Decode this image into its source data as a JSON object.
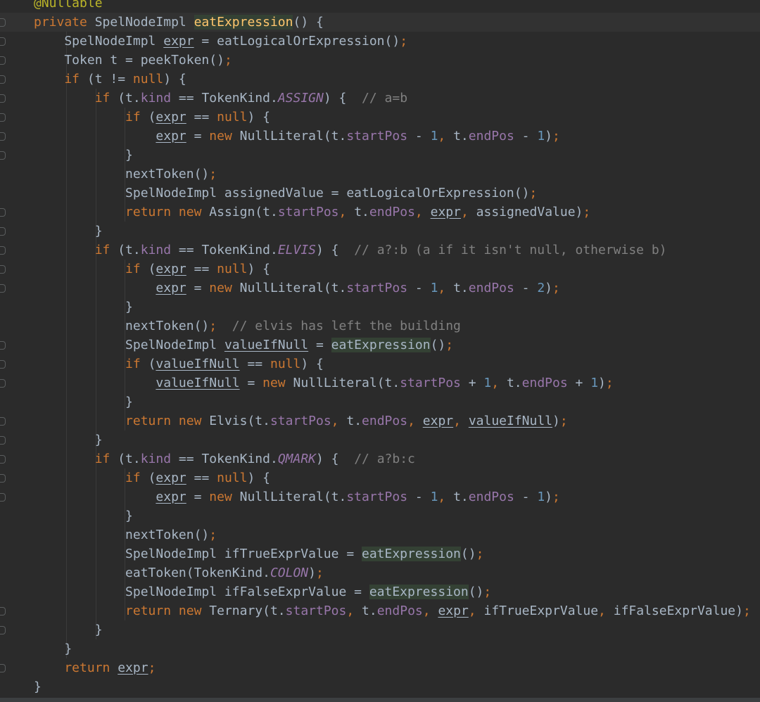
{
  "editor": {
    "language": "java",
    "lines": [
      [
        [
          "ann",
          "@Nullable"
        ]
      ],
      [
        [
          "kw",
          "private "
        ],
        [
          "",
          "SpelNodeImpl "
        ],
        [
          "fn hl",
          "eatExpression"
        ],
        [
          "",
          "() {"
        ]
      ],
      [
        [
          "",
          "    SpelNodeImpl "
        ],
        [
          "ul",
          "expr"
        ],
        [
          "",
          " = eatLogicalOrExpression()"
        ],
        [
          "kw",
          ";"
        ]
      ],
      [
        [
          "",
          "    Token t = peekToken()"
        ],
        [
          "kw",
          ";"
        ]
      ],
      [
        [
          "kw",
          "    if "
        ],
        [
          "",
          "(t != "
        ],
        [
          "kw",
          "null"
        ],
        [
          "",
          ") {"
        ]
      ],
      [
        [
          "",
          "        "
        ],
        [
          "kw",
          "if "
        ],
        [
          "",
          "(t."
        ],
        [
          "fld",
          "kind"
        ],
        [
          "",
          " == TokenKind."
        ],
        [
          "cst",
          "ASSIGN"
        ],
        [
          "",
          ") {  "
        ],
        [
          "cm",
          "// a=b"
        ]
      ],
      [
        [
          "",
          "            "
        ],
        [
          "kw",
          "if "
        ],
        [
          "",
          "("
        ],
        [
          "ul",
          "expr"
        ],
        [
          "",
          " == "
        ],
        [
          "kw",
          "null"
        ],
        [
          "",
          ") {"
        ]
      ],
      [
        [
          "",
          "                "
        ],
        [
          "ul",
          "expr"
        ],
        [
          "",
          " = "
        ],
        [
          "kw",
          "new "
        ],
        [
          "",
          "NullLiteral(t."
        ],
        [
          "fld",
          "startPos"
        ],
        [
          "",
          " - "
        ],
        [
          "num",
          "1"
        ],
        [
          "kw",
          ", "
        ],
        [
          "",
          "t."
        ],
        [
          "fld",
          "endPos"
        ],
        [
          "",
          " - "
        ],
        [
          "num",
          "1"
        ],
        [
          "",
          ")"
        ],
        [
          "kw",
          ";"
        ]
      ],
      [
        [
          "",
          "            }"
        ]
      ],
      [
        [
          "",
          "            nextToken()"
        ],
        [
          "kw",
          ";"
        ]
      ],
      [
        [
          "",
          "            SpelNodeImpl assignedValue = eatLogicalOrExpression()"
        ],
        [
          "kw",
          ";"
        ]
      ],
      [
        [
          "",
          "            "
        ],
        [
          "kw",
          "return new "
        ],
        [
          "",
          "Assign(t."
        ],
        [
          "fld",
          "startPos"
        ],
        [
          "kw",
          ", "
        ],
        [
          "",
          "t."
        ],
        [
          "fld",
          "endPos"
        ],
        [
          "kw",
          ", "
        ],
        [
          "ul",
          "expr"
        ],
        [
          "kw",
          ", "
        ],
        [
          "",
          "assignedValue)"
        ],
        [
          "kw",
          ";"
        ]
      ],
      [
        [
          "",
          "        }"
        ]
      ],
      [
        [
          "",
          "        "
        ],
        [
          "kw",
          "if "
        ],
        [
          "",
          "(t."
        ],
        [
          "fld",
          "kind"
        ],
        [
          "",
          " == TokenKind."
        ],
        [
          "cst",
          "ELVIS"
        ],
        [
          "",
          ") {  "
        ],
        [
          "cm",
          "// a?:b (a if it isn't null, otherwise b)"
        ]
      ],
      [
        [
          "",
          "            "
        ],
        [
          "kw",
          "if "
        ],
        [
          "",
          "("
        ],
        [
          "ul",
          "expr"
        ],
        [
          "",
          " == "
        ],
        [
          "kw",
          "null"
        ],
        [
          "",
          ") {"
        ]
      ],
      [
        [
          "",
          "                "
        ],
        [
          "ul",
          "expr"
        ],
        [
          "",
          " = "
        ],
        [
          "kw",
          "new "
        ],
        [
          "",
          "NullLiteral(t."
        ],
        [
          "fld",
          "startPos"
        ],
        [
          "",
          " - "
        ],
        [
          "num",
          "1"
        ],
        [
          "kw",
          ", "
        ],
        [
          "",
          "t."
        ],
        [
          "fld",
          "endPos"
        ],
        [
          "",
          " - "
        ],
        [
          "num",
          "2"
        ],
        [
          "",
          ")"
        ],
        [
          "kw",
          ";"
        ]
      ],
      [
        [
          "",
          "            }"
        ]
      ],
      [
        [
          "",
          "            nextToken()"
        ],
        [
          "kw",
          ";  "
        ],
        [
          "cm",
          "// elvis has left the building"
        ]
      ],
      [
        [
          "",
          "            SpelNodeImpl "
        ],
        [
          "ul",
          "valueIfNull"
        ],
        [
          "",
          " = "
        ],
        [
          "hl",
          "eatExpression"
        ],
        [
          "",
          "()"
        ],
        [
          "kw",
          ";"
        ]
      ],
      [
        [
          "",
          "            "
        ],
        [
          "kw",
          "if "
        ],
        [
          "",
          "("
        ],
        [
          "ul",
          "valueIfNull"
        ],
        [
          "",
          " == "
        ],
        [
          "kw",
          "null"
        ],
        [
          "",
          ") {"
        ]
      ],
      [
        [
          "",
          "                "
        ],
        [
          "ul",
          "valueIfNull"
        ],
        [
          "",
          " = "
        ],
        [
          "kw",
          "new "
        ],
        [
          "",
          "NullLiteral(t."
        ],
        [
          "fld",
          "startPos"
        ],
        [
          "",
          " + "
        ],
        [
          "num",
          "1"
        ],
        [
          "kw",
          ", "
        ],
        [
          "",
          "t."
        ],
        [
          "fld",
          "endPos"
        ],
        [
          "",
          " + "
        ],
        [
          "num",
          "1"
        ],
        [
          "",
          ")"
        ],
        [
          "kw",
          ";"
        ]
      ],
      [
        [
          "",
          "            }"
        ]
      ],
      [
        [
          "",
          "            "
        ],
        [
          "kw",
          "return new "
        ],
        [
          "",
          "Elvis(t."
        ],
        [
          "fld",
          "startPos"
        ],
        [
          "kw",
          ", "
        ],
        [
          "",
          "t."
        ],
        [
          "fld",
          "endPos"
        ],
        [
          "kw",
          ", "
        ],
        [
          "ul",
          "expr"
        ],
        [
          "kw",
          ", "
        ],
        [
          "ul",
          "valueIfNull"
        ],
        [
          "",
          ")"
        ],
        [
          "kw",
          ";"
        ]
      ],
      [
        [
          "",
          "        }"
        ]
      ],
      [
        [
          "",
          "        "
        ],
        [
          "kw",
          "if "
        ],
        [
          "",
          "(t."
        ],
        [
          "fld",
          "kind"
        ],
        [
          "",
          " == TokenKind."
        ],
        [
          "cst",
          "QMARK"
        ],
        [
          "",
          ") {  "
        ],
        [
          "cm",
          "// a?b:c"
        ]
      ],
      [
        [
          "",
          "            "
        ],
        [
          "kw",
          "if "
        ],
        [
          "",
          "("
        ],
        [
          "ul",
          "expr"
        ],
        [
          "",
          " == "
        ],
        [
          "kw",
          "null"
        ],
        [
          "",
          ") {"
        ]
      ],
      [
        [
          "",
          "                "
        ],
        [
          "ul",
          "expr"
        ],
        [
          "",
          " = "
        ],
        [
          "kw",
          "new "
        ],
        [
          "",
          "NullLiteral(t."
        ],
        [
          "fld",
          "startPos"
        ],
        [
          "",
          " - "
        ],
        [
          "num",
          "1"
        ],
        [
          "kw",
          ", "
        ],
        [
          "",
          "t."
        ],
        [
          "fld",
          "endPos"
        ],
        [
          "",
          " - "
        ],
        [
          "num",
          "1"
        ],
        [
          "",
          ")"
        ],
        [
          "kw",
          ";"
        ]
      ],
      [
        [
          "",
          "            }"
        ]
      ],
      [
        [
          "",
          "            nextToken()"
        ],
        [
          "kw",
          ";"
        ]
      ],
      [
        [
          "",
          "            SpelNodeImpl ifTrueExprValue = "
        ],
        [
          "hl",
          "eatExpression"
        ],
        [
          "",
          "()"
        ],
        [
          "kw",
          ";"
        ]
      ],
      [
        [
          "",
          "            eatToken(TokenKind."
        ],
        [
          "cst",
          "COLON"
        ],
        [
          "",
          ")"
        ],
        [
          "kw",
          ";"
        ]
      ],
      [
        [
          "",
          "            SpelNodeImpl ifFalseExprValue = "
        ],
        [
          "hl",
          "eatExpression"
        ],
        [
          "",
          "()"
        ],
        [
          "kw",
          ";"
        ]
      ],
      [
        [
          "",
          "            "
        ],
        [
          "kw",
          "return new "
        ],
        [
          "",
          "Ternary(t."
        ],
        [
          "fld",
          "startPos"
        ],
        [
          "kw",
          ", "
        ],
        [
          "",
          "t."
        ],
        [
          "fld",
          "endPos"
        ],
        [
          "kw",
          ", "
        ],
        [
          "ul",
          "expr"
        ],
        [
          "kw",
          ", "
        ],
        [
          "",
          "ifTrueExprValue"
        ],
        [
          "kw",
          ", "
        ],
        [
          "",
          "ifFalseExprValue)"
        ],
        [
          "kw",
          ";"
        ]
      ],
      [
        [
          "",
          "        }"
        ]
      ],
      [
        [
          "",
          "    }"
        ]
      ],
      [
        [
          "kw",
          "    return "
        ],
        [
          "ul",
          "expr"
        ],
        [
          "kw",
          ";"
        ]
      ],
      [
        [
          "",
          "}"
        ]
      ]
    ],
    "current_line": 1,
    "gutter_marks": [
      1,
      2,
      3,
      4,
      5,
      6,
      7,
      8,
      11,
      12,
      13,
      14,
      15,
      18,
      19,
      20,
      22,
      23,
      24,
      25,
      26,
      32,
      33,
      35
    ]
  }
}
